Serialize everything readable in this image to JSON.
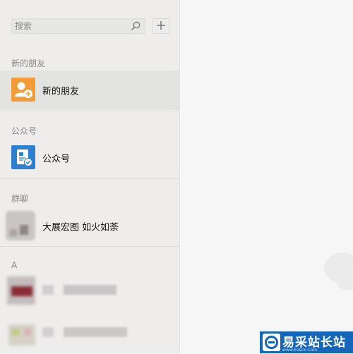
{
  "search": {
    "placeholder": "搜索"
  },
  "sections": {
    "new_friends": {
      "header": "新的朋友",
      "item_label": "新的朋友"
    },
    "official": {
      "header": "公众号",
      "item_label": "公众号"
    },
    "group": {
      "header": "群聊",
      "item_label": "大展宏图 如火如荼"
    },
    "letter_a": {
      "header": "A"
    }
  },
  "colors": {
    "new_friend_avatar": "#f29c38",
    "official_avatar": "#2f7fd1",
    "watermark_bg": "#1467b8"
  },
  "watermark": {
    "text": "易采站长站",
    "url": "www.Easck.Com"
  },
  "icons": {
    "search": "search-icon",
    "add": "plus-icon",
    "new_friend": "add-friend-icon",
    "official": "official-account-icon"
  }
}
